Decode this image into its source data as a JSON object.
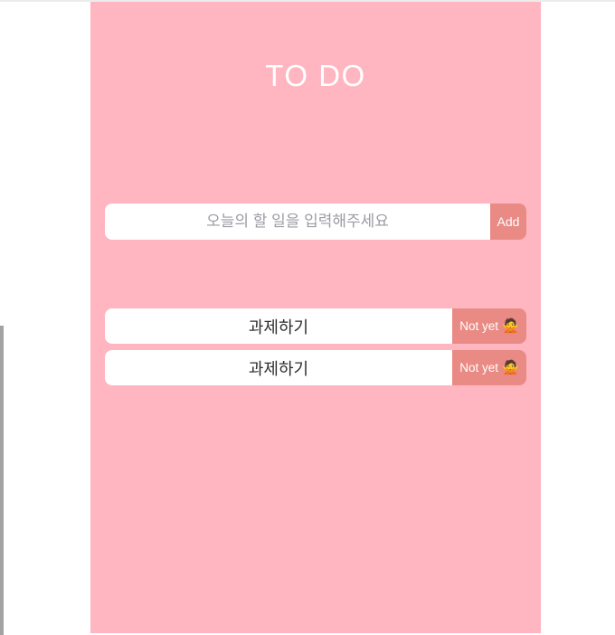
{
  "app": {
    "title": "TO DO",
    "panel_color": "#ffb6c1",
    "accent_color": "#e98a84",
    "title_color": "#ffffff"
  },
  "entry": {
    "input_value": "",
    "input_placeholder": "오늘의 할 일을 입력해주세요",
    "add_label": "Add"
  },
  "todos": [
    {
      "text": "과제하기",
      "status_label": "Not yet",
      "status_emoji": "🙅",
      "status_icon_name": "person-gesturing-no-icon"
    },
    {
      "text": "과제하기",
      "status_label": "Not yet",
      "status_emoji": "🙅",
      "status_icon_name": "person-gesturing-no-icon"
    }
  ]
}
